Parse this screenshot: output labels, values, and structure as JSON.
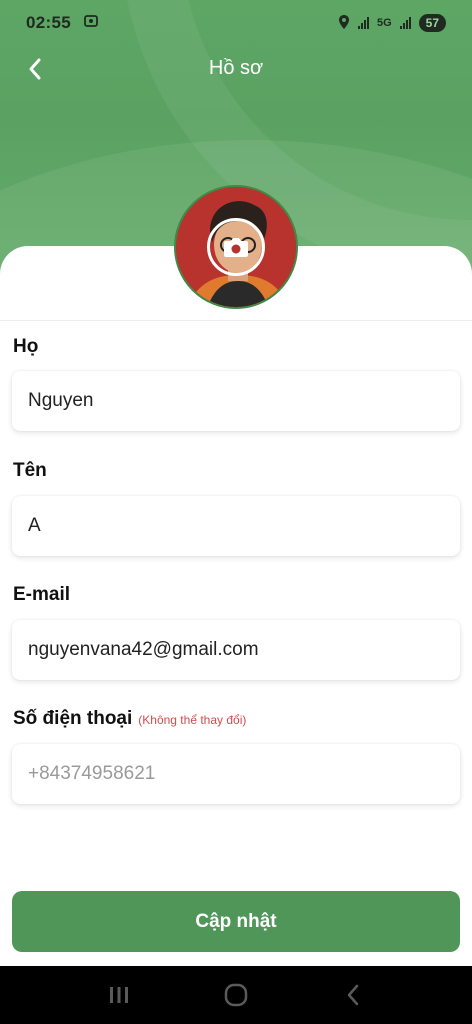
{
  "status_bar": {
    "time": "02:55",
    "network": "5G",
    "battery": "57"
  },
  "header": {
    "title": "Hồ sơ"
  },
  "form": {
    "last_name": {
      "label": "Họ",
      "value": "Nguyen"
    },
    "first_name": {
      "label": "Tên",
      "value": "A"
    },
    "email": {
      "label": "E-mail",
      "value": "nguyenvana42@gmail.com"
    },
    "phone": {
      "label": "Số điện thoại",
      "note": "(Không thể thay đổi)",
      "value": "+84374958621"
    }
  },
  "actions": {
    "update_label": "Cập nhật"
  },
  "colors": {
    "brand_green": "#4f9658",
    "header_green": "#5da664",
    "note_red": "#d34b4b"
  },
  "icons": {
    "back": "chevron-left-icon",
    "camera": "camera-icon",
    "nav_recent": "recent-apps-icon",
    "nav_home": "home-icon",
    "nav_back": "nav-back-icon"
  }
}
